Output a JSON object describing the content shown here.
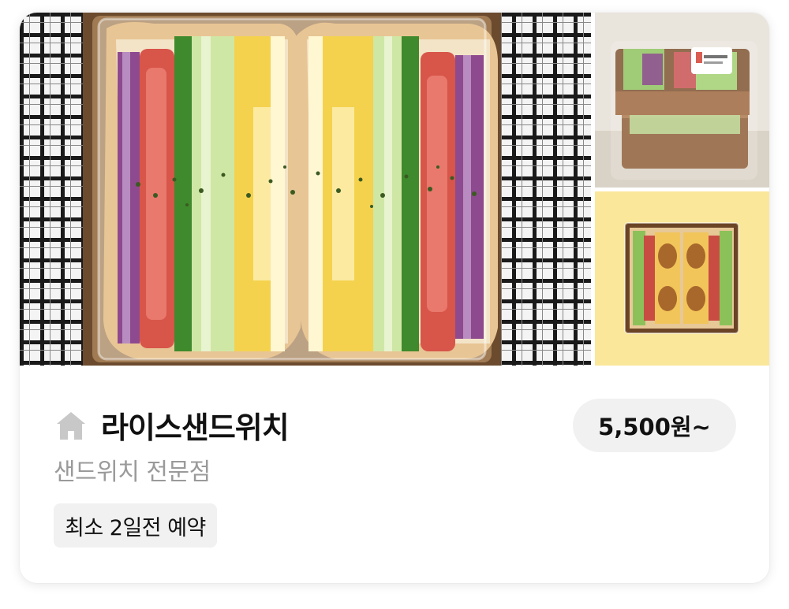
{
  "store": {
    "icon": "home-icon",
    "name": "라이스샌드위치",
    "category": "샌드위치 전문점",
    "reservation_badge": "최소 2일전 예약",
    "price": "5,500원~"
  },
  "gallery": {
    "main_photo": "sandwich-cross-section-photo",
    "side_photo_top": "boxed-sandwich-stack-photo",
    "side_photo_bottom": "sandwich-box-on-yellow-photo"
  },
  "colors": {
    "card_bg": "#ffffff",
    "pill_bg": "#f1f1f1",
    "secondary_text": "#9a9a9a",
    "primary_text": "#111111",
    "icon_gray": "#c8c8c8",
    "yellow_bg": "#fbe79a"
  }
}
